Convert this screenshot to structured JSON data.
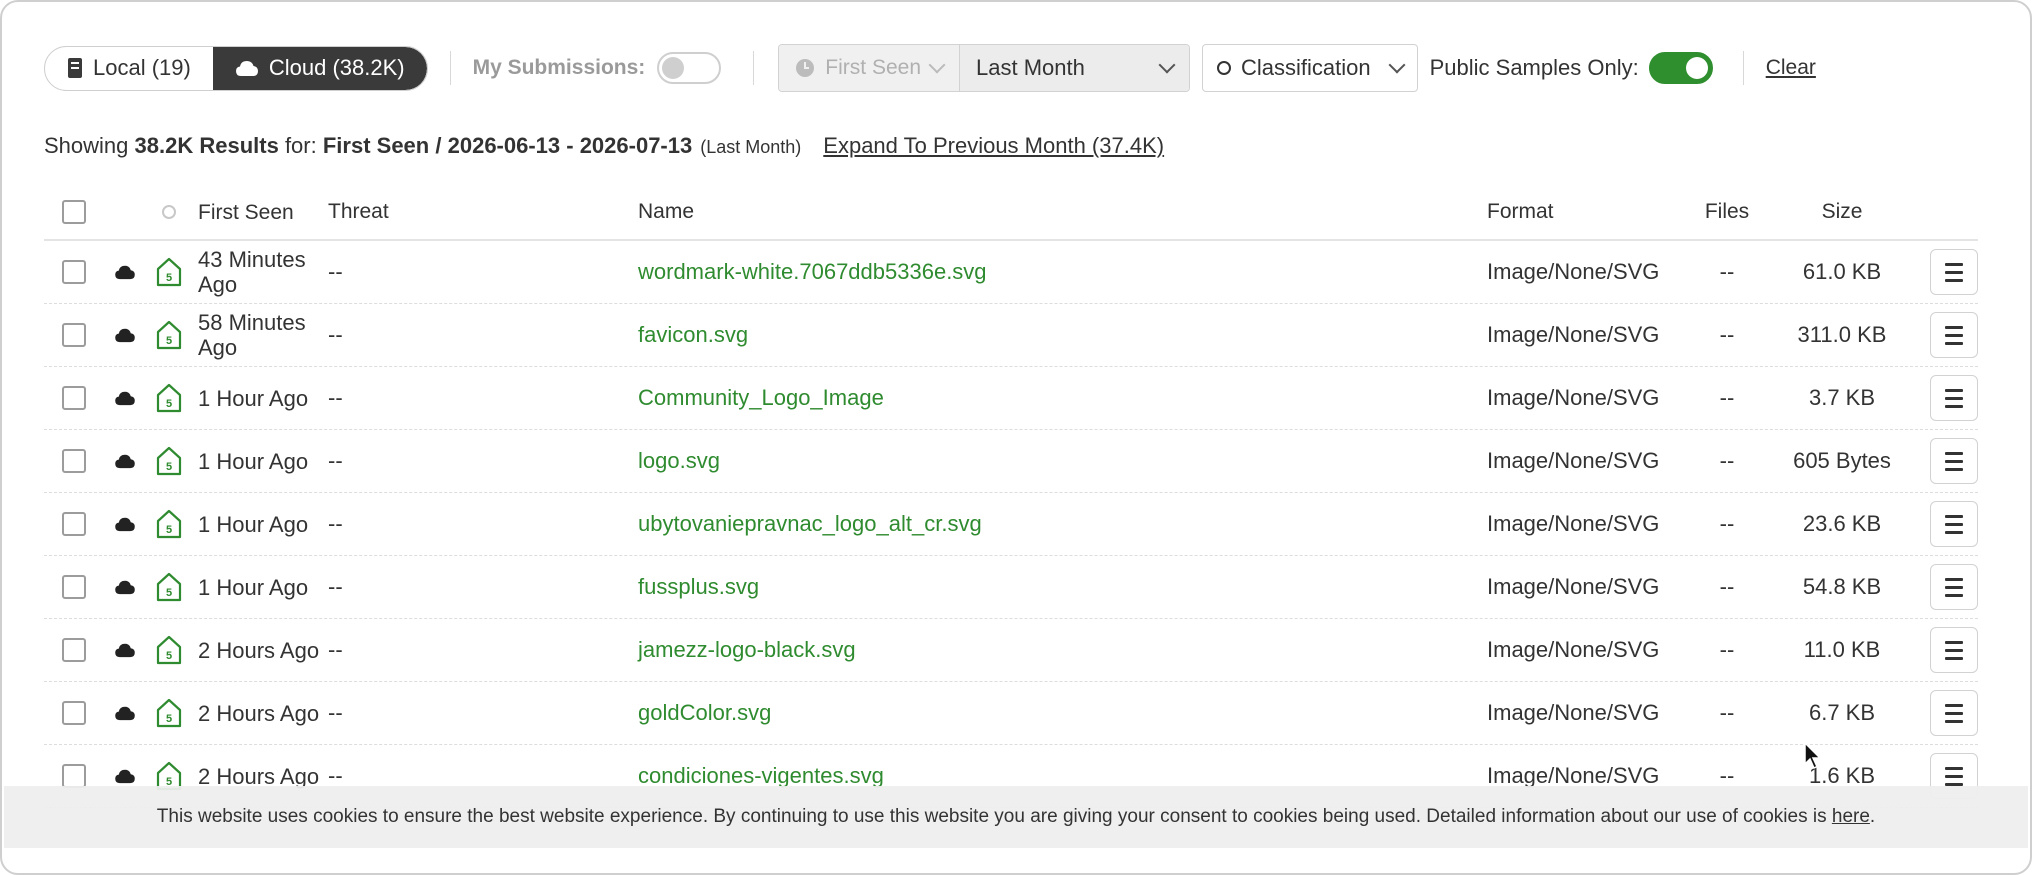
{
  "toolbar": {
    "local_label": "Local (19)",
    "cloud_label": "Cloud (38.2K)",
    "my_submissions_label": "My Submissions:",
    "my_submissions_on": false,
    "date_type": "First Seen",
    "date_range": "Last Month",
    "classification_label": "Classification",
    "public_label": "Public Samples Only:",
    "public_on": true,
    "clear_label": "Clear",
    "toggle_color": "#2f8f2f"
  },
  "summary": {
    "prefix": "Showing",
    "count": "38.2K Results",
    "for_label": "for:",
    "filter_field": "First Seen",
    "slash": "/",
    "dates": "2026-06-13 - 2026-07-13",
    "range_note": "(Last Month)",
    "expand_label": "Expand To Previous Month (37.4K)"
  },
  "columns": {
    "first_seen": "First Seen",
    "threat": "Threat",
    "name": "Name",
    "format": "Format",
    "files": "Files",
    "size": "Size"
  },
  "rows": [
    {
      "first_seen": "43 Minutes Ago",
      "threat": "--",
      "name": "wordmark-white.7067ddb5336e.svg",
      "format": "Image/None/SVG",
      "files": "--",
      "size": "61.0 KB"
    },
    {
      "first_seen": "58 Minutes Ago",
      "threat": "--",
      "name": "favicon.svg",
      "format": "Image/None/SVG",
      "files": "--",
      "size": "311.0 KB"
    },
    {
      "first_seen": "1 Hour Ago",
      "threat": "--",
      "name": "Community_Logo_Image",
      "format": "Image/None/SVG",
      "files": "--",
      "size": "3.7 KB"
    },
    {
      "first_seen": "1 Hour Ago",
      "threat": "--",
      "name": "logo.svg",
      "format": "Image/None/SVG",
      "files": "--",
      "size": "605 Bytes"
    },
    {
      "first_seen": "1 Hour Ago",
      "threat": "--",
      "name": "ubytovaniepravnac_logo_alt_cr.svg",
      "format": "Image/None/SVG",
      "files": "--",
      "size": "23.6 KB"
    },
    {
      "first_seen": "1 Hour Ago",
      "threat": "--",
      "name": "fussplus.svg",
      "format": "Image/None/SVG",
      "files": "--",
      "size": "54.8 KB"
    },
    {
      "first_seen": "2 Hours Ago",
      "threat": "--",
      "name": "jamezz-logo-black.svg",
      "format": "Image/None/SVG",
      "files": "--",
      "size": "11.0 KB"
    },
    {
      "first_seen": "2 Hours Ago",
      "threat": "--",
      "name": "goldColor.svg",
      "format": "Image/None/SVG",
      "files": "--",
      "size": "6.7 KB"
    },
    {
      "first_seen": "2 Hours Ago",
      "threat": "--",
      "name": "condiciones-vigentes.svg",
      "format": "Image/None/SVG",
      "files": "--",
      "size": "1.6 KB"
    }
  ],
  "row_badge": "5",
  "icons": {
    "server": "server-icon",
    "cloud": "cloud-icon",
    "clock": "clock-icon",
    "house_badge": "file-type-badge-icon",
    "menu": "hamburger-menu-icon"
  },
  "colors": {
    "accent_green": "#2f8b2f",
    "dark_segment": "#3a3a3a"
  },
  "cookie": {
    "text": "This website uses cookies to ensure the best website experience. By continuing to use this website you are giving your consent to cookies being used. Detailed information about our use of cookies is",
    "link": "here",
    "end": "."
  }
}
